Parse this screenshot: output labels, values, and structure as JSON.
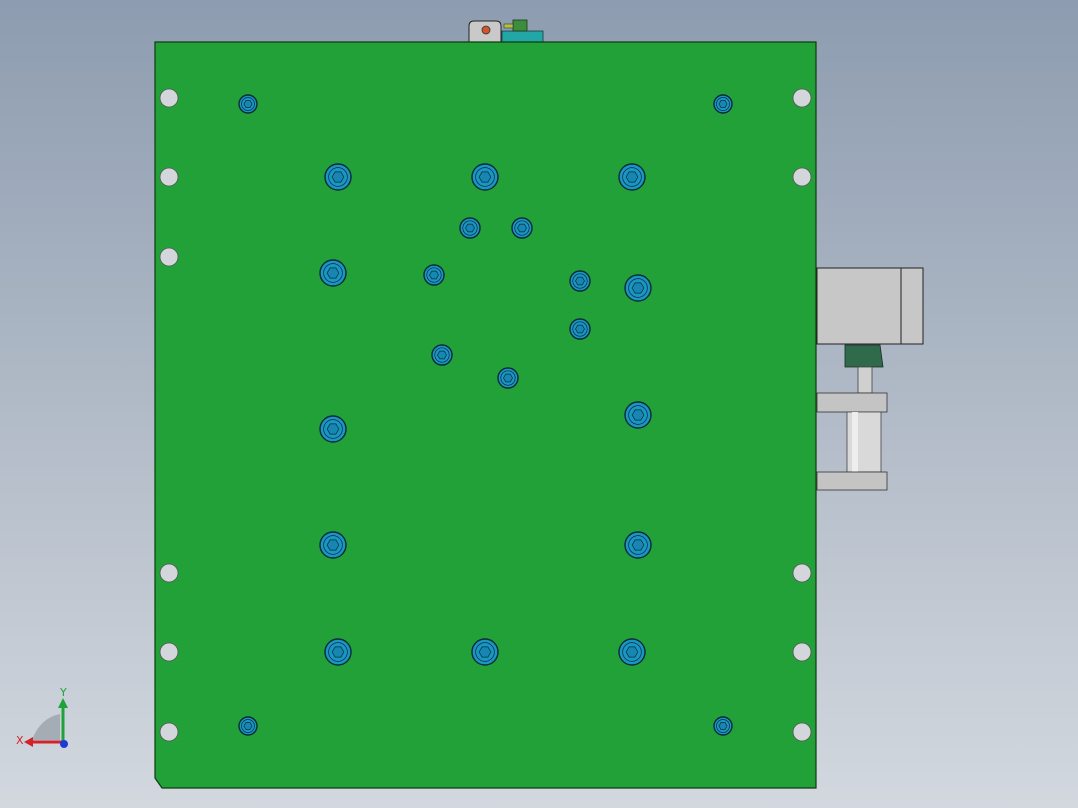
{
  "scene": {
    "background_top": "#8d9cb0",
    "background_bottom": "#d3d8df",
    "plate_color": "#21a137",
    "plate_edge": "#0d3d12",
    "bolt_color": "#1996c4",
    "hole_color": "#d3d6da",
    "cylinder_color": "#c4c4c4",
    "bracket_color": "#2f6b4a",
    "teal_block_color": "#23a6a6"
  },
  "triad": {
    "y_label": "Y",
    "x_label": "X",
    "y_axis_color": "#1fa23a",
    "x_axis_color": "#d3232a",
    "z_axis_color": "#1e3ad6"
  }
}
